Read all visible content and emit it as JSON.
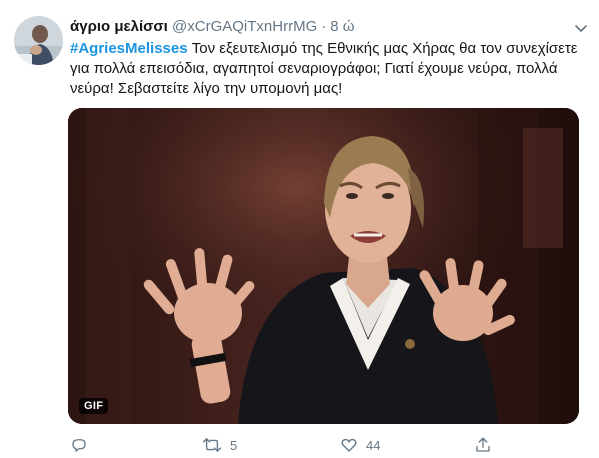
{
  "tweet": {
    "display_name": "άγριο μελίσσι",
    "handle": "@xCrGAQiTxnHrrMG",
    "separator": "·",
    "time": "8 ώ",
    "hashtag": "#AgriesMelisses",
    "body": " Τον εξευτελισμό της Εθνικής μας Χήρας θα τον συνεχίσετε για πολλά επεισόδια, αγαπητοί σεναριογράφοι; Γιατί έχουμε νεύρα, πολλά νεύρα! Σεβαστείτε λίγο την υπομονή μας!",
    "media_badge": "GIF",
    "retweet_count": "5",
    "like_count": "44"
  },
  "icons": {
    "menu": "chevron-down-icon",
    "reply": "reply-icon",
    "retweet": "retweet-icon",
    "like": "heart-icon",
    "share": "share-icon"
  },
  "colors": {
    "text": "#14171a",
    "secondary": "#657786",
    "hashtag": "#1b95e0"
  }
}
